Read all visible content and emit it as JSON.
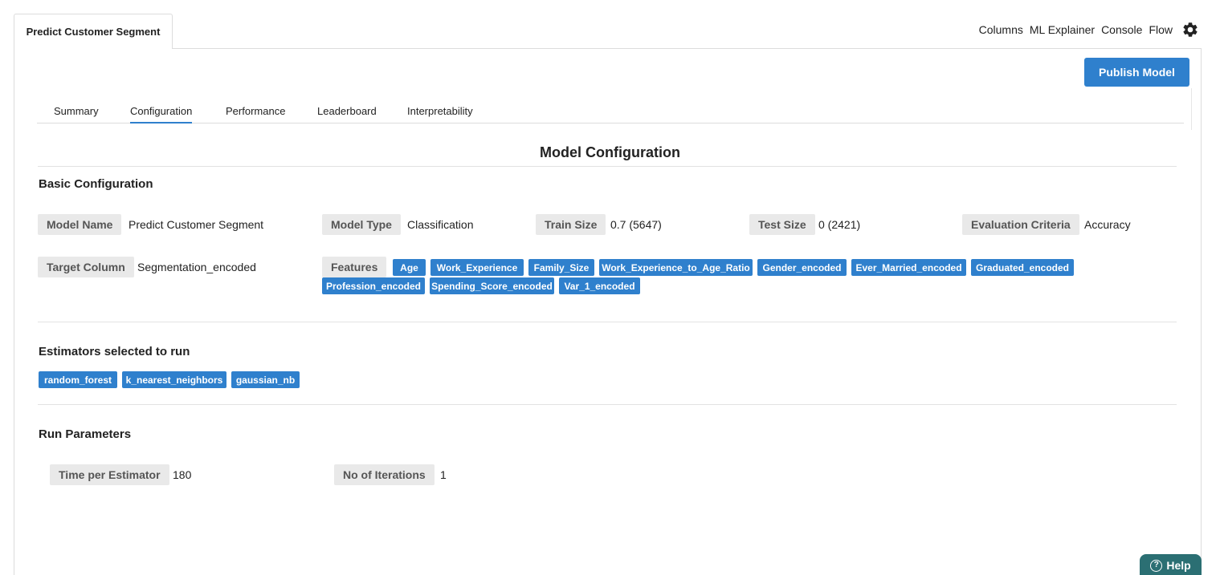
{
  "page_tab": "Predict Customer Segment",
  "top_links": [
    "Columns",
    "ML Explainer",
    "Console",
    "Flow"
  ],
  "icons": {
    "settings": "gear-icon",
    "help": "question-circle-icon"
  },
  "publish_button": "Publish Model",
  "tabs": [
    "Summary",
    "Configuration",
    "Performance",
    "Leaderboard",
    "Interpretability"
  ],
  "active_tab": "Configuration",
  "section_title": "Model Configuration",
  "basic": {
    "heading": "Basic Configuration",
    "model_name_label": "Model Name",
    "model_name": "Predict Customer Segment",
    "model_type_label": "Model Type",
    "model_type": "Classification",
    "train_size_label": "Train Size",
    "train_size": "0.7 (5647)",
    "test_size_label": "Test Size",
    "test_size": "0 (2421)",
    "evaluation_label": "Evaluation Criteria",
    "evaluation": "Accuracy",
    "target_label": "Target Column",
    "target": "Segmentation_encoded",
    "features_label": "Features",
    "features": [
      "Age",
      "Work_Experience",
      "Family_Size",
      "Work_Experience_to_Age_Ratio",
      "Gender_encoded",
      "Ever_Married_encoded",
      "Graduated_encoded",
      "Profession_encoded",
      "Spending_Score_encoded",
      "Var_1_encoded"
    ]
  },
  "estimators": {
    "heading": "Estimators selected to run",
    "items": [
      "random_forest",
      "k_nearest_neighbors",
      "gaussian_nb"
    ]
  },
  "run_params": {
    "heading": "Run Parameters",
    "time_label": "Time per Estimator",
    "time": "180",
    "iterations_label": "No of Iterations",
    "iterations": "1"
  },
  "help": "Help",
  "colors": {
    "accent": "#2f80cd",
    "label_bg": "#e9e9e9",
    "help_bg": "#2b6f73"
  }
}
